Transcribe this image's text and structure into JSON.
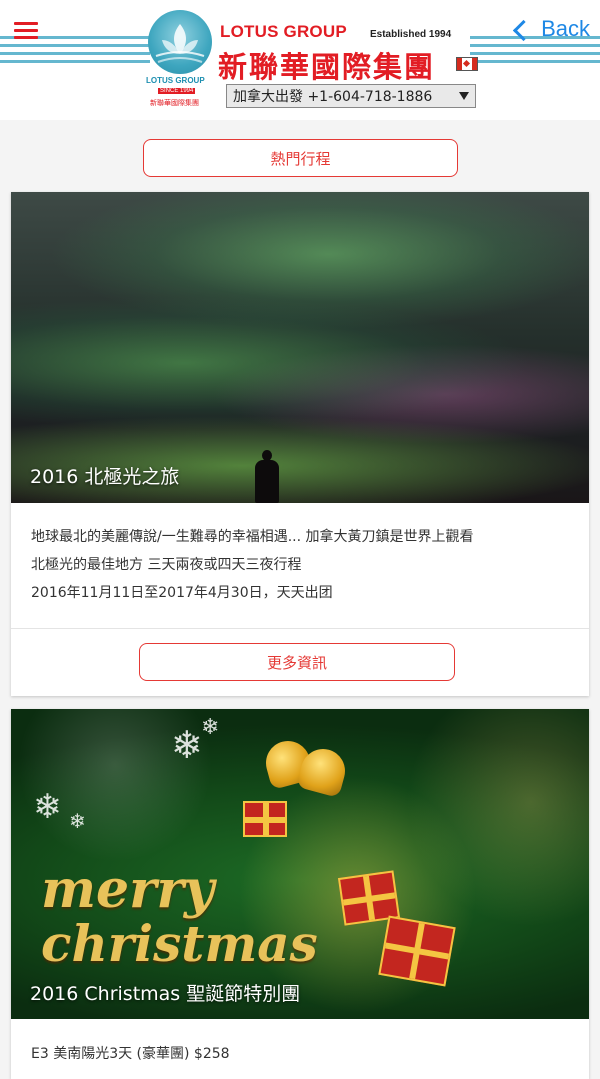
{
  "header": {
    "back_label": "Back",
    "brand_en": "LOTUS GROUP",
    "established": "Established 1994",
    "brand_cn": "新聯華國際集團",
    "logo_text": "LOTUS GROUP",
    "logo_since": "SINCE 1994",
    "logo_cn": "新聯華國際集團",
    "phone_selected": "加拿大出發 +1-604-718-1886"
  },
  "section": {
    "hot_tours_label": "熱門行程"
  },
  "cards": [
    {
      "image_title": "2016 北極光之旅",
      "description_lines": [
        "地球最北的美麗傳說/一生難尋的幸福相遇... 加拿大黃刀鎮是世界上觀看",
        "北極光的最佳地方 三天兩夜或四天三夜行程",
        "2016年11月11日至2017年4月30日，天天出团"
      ],
      "more_label": "更多資訊"
    },
    {
      "image_title": "2016 Christmas 聖誕節特別團",
      "image_script_1": "merry",
      "image_script_2": "christmas",
      "description_lines": [
        "E3 美南陽光3天 (豪華團) $258"
      ]
    }
  ],
  "colors": {
    "accent_red": "#e21d24",
    "back_blue": "#1e88e5",
    "stripe_blue": "#65b7cf"
  },
  "icons": [
    "menu-icon",
    "chevron-left-icon",
    "canada-flag-icon",
    "dropdown-caret-icon",
    "lotus-logo"
  ]
}
